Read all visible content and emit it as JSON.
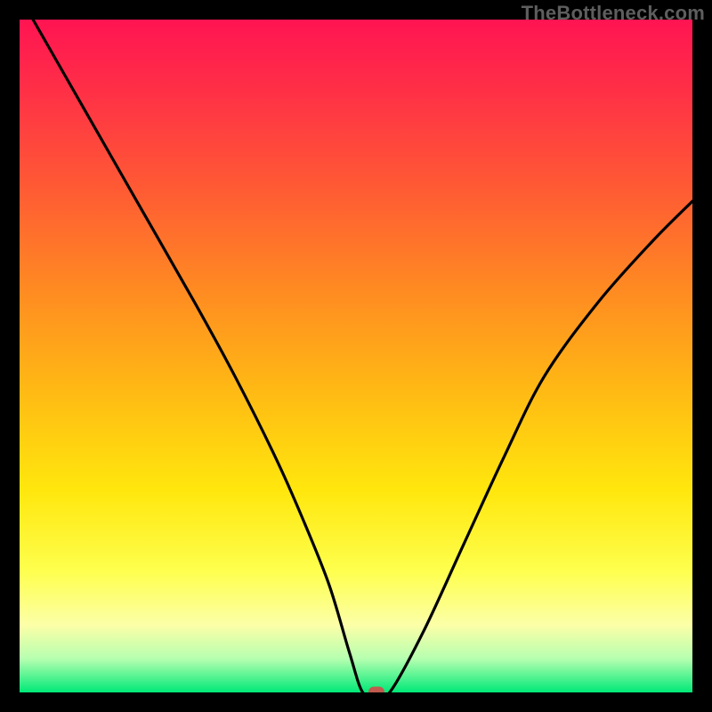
{
  "watermark": "TheBottleneck.com",
  "chart_data": {
    "type": "line",
    "title": "",
    "xlabel": "",
    "ylabel": "",
    "xlim": [
      0,
      100
    ],
    "ylim": [
      0,
      100
    ],
    "series": [
      {
        "name": "curve",
        "x": [
          2,
          10,
          18,
          26,
          32,
          38,
          42,
          46,
          49,
          51,
          53,
          55,
          60,
          66,
          72,
          78,
          86,
          94,
          100
        ],
        "y": [
          100,
          86,
          72,
          58,
          47,
          35,
          26,
          16,
          6,
          0,
          0,
          0,
          9,
          22,
          35,
          47,
          58,
          67,
          73
        ]
      }
    ],
    "marker": {
      "x": 53,
      "y": 0,
      "color": "#c15a4e"
    },
    "gradient_stops": [
      {
        "pos": 0,
        "color": "#ff1452"
      },
      {
        "pos": 10,
        "color": "#ff2e47"
      },
      {
        "pos": 25,
        "color": "#ff5a34"
      },
      {
        "pos": 40,
        "color": "#ff8a22"
      },
      {
        "pos": 55,
        "color": "#ffb914"
      },
      {
        "pos": 70,
        "color": "#ffe70d"
      },
      {
        "pos": 82,
        "color": "#feff4e"
      },
      {
        "pos": 90,
        "color": "#fcffa7"
      },
      {
        "pos": 95,
        "color": "#b6ffb0"
      },
      {
        "pos": 100,
        "color": "#00e977"
      }
    ]
  }
}
